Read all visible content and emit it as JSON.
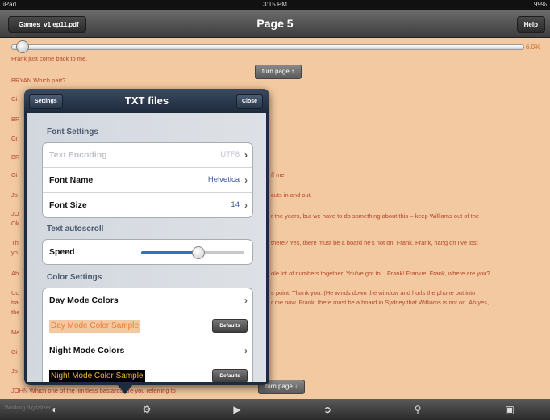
{
  "status": {
    "device": "iPad",
    "time": "3:15 PM",
    "battery": "99%"
  },
  "navbar": {
    "back_label": "Games_v1 ep11.pdf",
    "title": "Page 5",
    "help_label": "Help"
  },
  "reader": {
    "progress_label": "6.0%",
    "progress": 0.02,
    "lines": [
      "Frank just come back to me.",
      "BRYAN    Which part?"
    ],
    "right_fragments": [
      "ff me.",
      "cuts in and out.",
      "r the years, but we have to do something about this – keep Williams out of the",
      "there? Yes, there must be a board he's not on, Frank. Frank, hang on I've lost",
      "ole lot of numbers together. You've got to... Frank! Frankie! Frank, where are you?",
      "s point. Thank you. (He winds down the window and hurls the phone out into",
      "r me now. Frank, there must be a board in Sydney that Williams is not on. Ah yes,"
    ],
    "left_fragments": [
      "Gi",
      "BR",
      "Gi",
      "BR",
      "Gi",
      "Jo",
      "JO",
      "Ok",
      "Th",
      "yo",
      "Ah",
      "Uc",
      "tra",
      "the",
      "Me",
      "Gi",
      "Jo"
    ],
    "bottom_line": "JOHN    Which one of the limitless bastards are you referring to",
    "turn_page_up": "turn page",
    "turn_page_down": "turn page"
  },
  "toolbar": {
    "left_text": "Working digitalizer"
  },
  "popover": {
    "title": "TXT files",
    "settings_label": "Settings",
    "close_label": "Close",
    "font_section": "Font Settings",
    "font_rows": [
      {
        "label": "Text Encoding",
        "value": "UTF8"
      },
      {
        "label": "Font Name",
        "value": "Helvetica"
      },
      {
        "label": "Font Size",
        "value": "14"
      }
    ],
    "autoscroll_section": "Text autoscroll",
    "speed_label": "Speed",
    "speed_value": 0.55,
    "color_section": "Color Settings",
    "day_colors_label": "Day Mode Colors",
    "day_sample": "Day Mode Color Sample",
    "night_colors_label": "Night Mode Colors",
    "night_sample": "Night Mode Color Sample",
    "defaults_label": "Defaults",
    "colors": {
      "day_text": "#f07a3a",
      "day_bg": "#f2c9a0",
      "night_text": "#f0b53a",
      "night_bg": "#000000"
    }
  }
}
